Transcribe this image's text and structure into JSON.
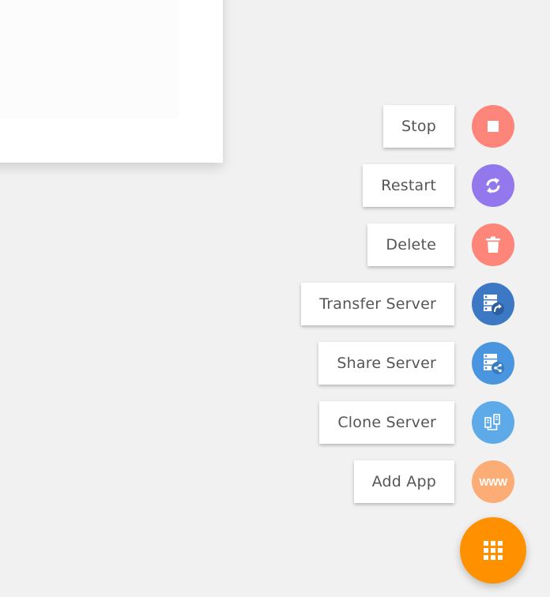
{
  "speed_dial": {
    "actions": [
      {
        "label": "Stop",
        "icon": "stop-icon",
        "color": "#fd857a"
      },
      {
        "label": "Restart",
        "icon": "refresh-icon",
        "color": "#9278ec"
      },
      {
        "label": "Delete",
        "icon": "trash-icon",
        "color": "#fd857a"
      },
      {
        "label": "Transfer Server",
        "icon": "server-transfer-icon",
        "color": "#3c78c3"
      },
      {
        "label": "Share Server",
        "icon": "server-share-icon",
        "color": "#4a95e0"
      },
      {
        "label": "Clone Server",
        "icon": "server-clone-icon",
        "color": "#5eaae8"
      },
      {
        "label": "Add App",
        "icon": "www-icon",
        "color": "#fcad76",
        "icon_text": "WWW"
      }
    ],
    "main_button": {
      "icon": "grid-icon",
      "color": "#ff9100"
    }
  }
}
